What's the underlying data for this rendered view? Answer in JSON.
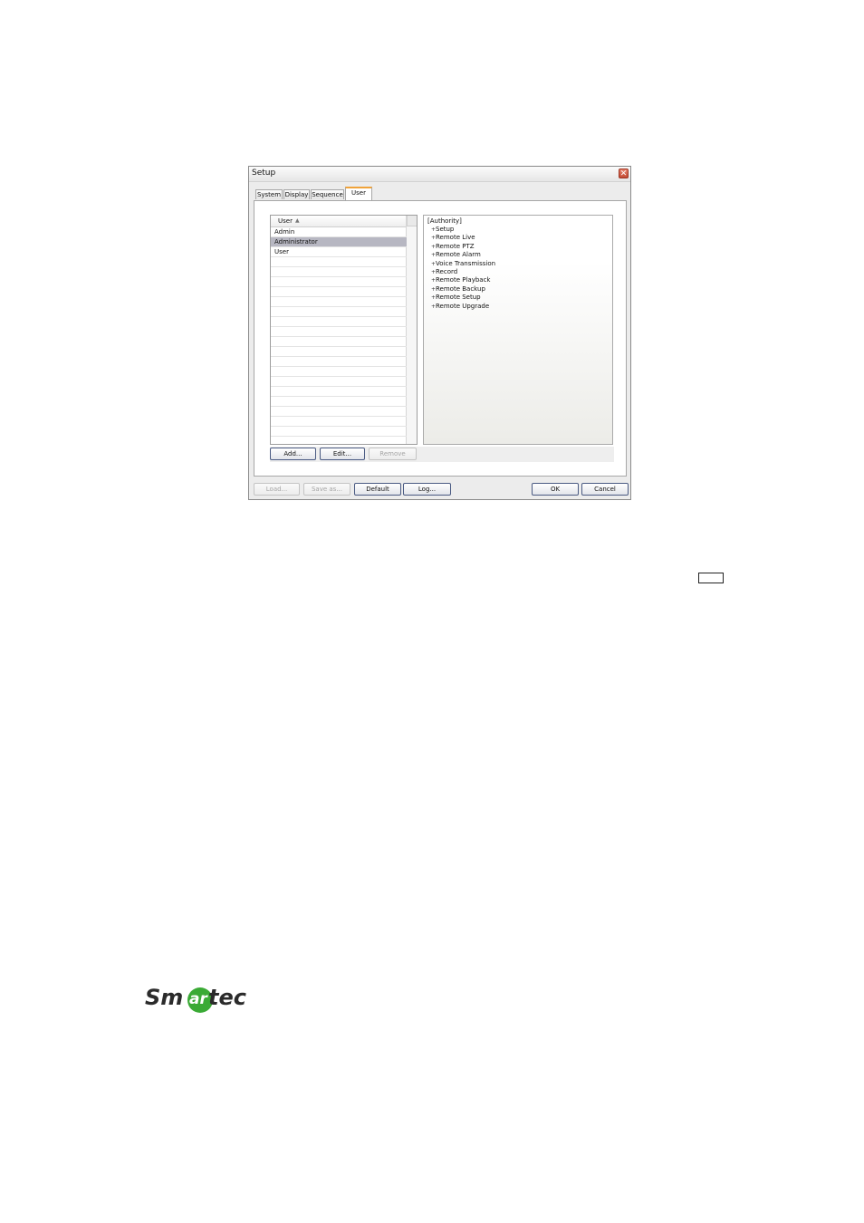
{
  "window": {
    "title": "Setup"
  },
  "tabs": [
    "System",
    "Display",
    "Sequence",
    "User"
  ],
  "active_tab": "User",
  "user_list": {
    "header": "User",
    "items": [
      "Admin",
      "Administrator",
      "User"
    ],
    "selected": "Administrator"
  },
  "authority": {
    "title": "[Authority]",
    "items": [
      "Setup",
      "Remote Live",
      "Remote PTZ",
      "Remote Alarm",
      "Voice Transmission",
      "Record",
      "Remote Playback",
      "Remote Backup",
      "Remote Setup",
      "Remote Upgrade"
    ]
  },
  "list_buttons": {
    "add": "Add...",
    "edit": "Edit...",
    "remove": "Remove"
  },
  "footer_buttons": {
    "load": "Load...",
    "save_as": "Save as...",
    "default": "Default",
    "log": "Log...",
    "ok": "OK",
    "cancel": "Cancel"
  },
  "logo": {
    "text": "Smartec",
    "colors": {
      "text": "#2b2b2b",
      "circle": "#3aaa35"
    }
  },
  "colors": {
    "active_tab_accent": "#f0a33a",
    "close_button": "#c24a33",
    "selection": "#b7b7c2"
  }
}
